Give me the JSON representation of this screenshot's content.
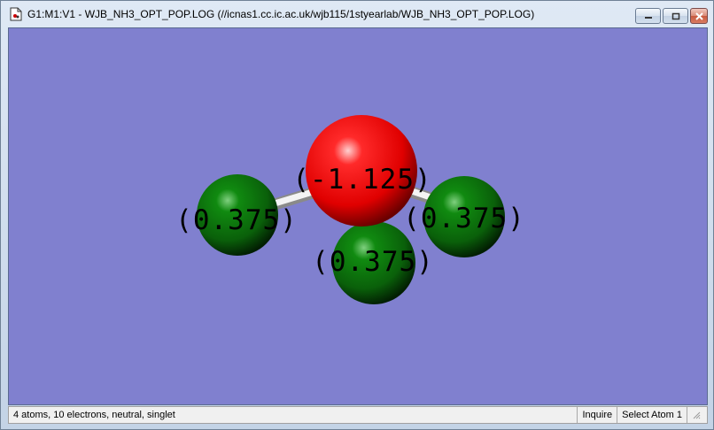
{
  "window": {
    "title": "G1:M1:V1 - WJB_NH3_OPT_POP.LOG (//icnas1.cc.ic.ac.uk/wjb115/1styearlab/WJB_NH3_OPT_POP.LOG)"
  },
  "viewer": {
    "background_color": "#8080cf",
    "atoms": [
      {
        "element": "N",
        "label": "(-1.125)",
        "color": "#ff0000"
      },
      {
        "element": "H",
        "label": "(0.375)",
        "color": "#0a6e0a"
      },
      {
        "element": "H",
        "label": "(0.375)",
        "color": "#0a6e0a"
      },
      {
        "element": "H",
        "label": "(0.375)",
        "color": "#0a6e0a"
      }
    ]
  },
  "status": {
    "summary": "4 atoms, 10 electrons, neutral, singlet",
    "mode": "Inquire",
    "action": "Select Atom 1"
  }
}
